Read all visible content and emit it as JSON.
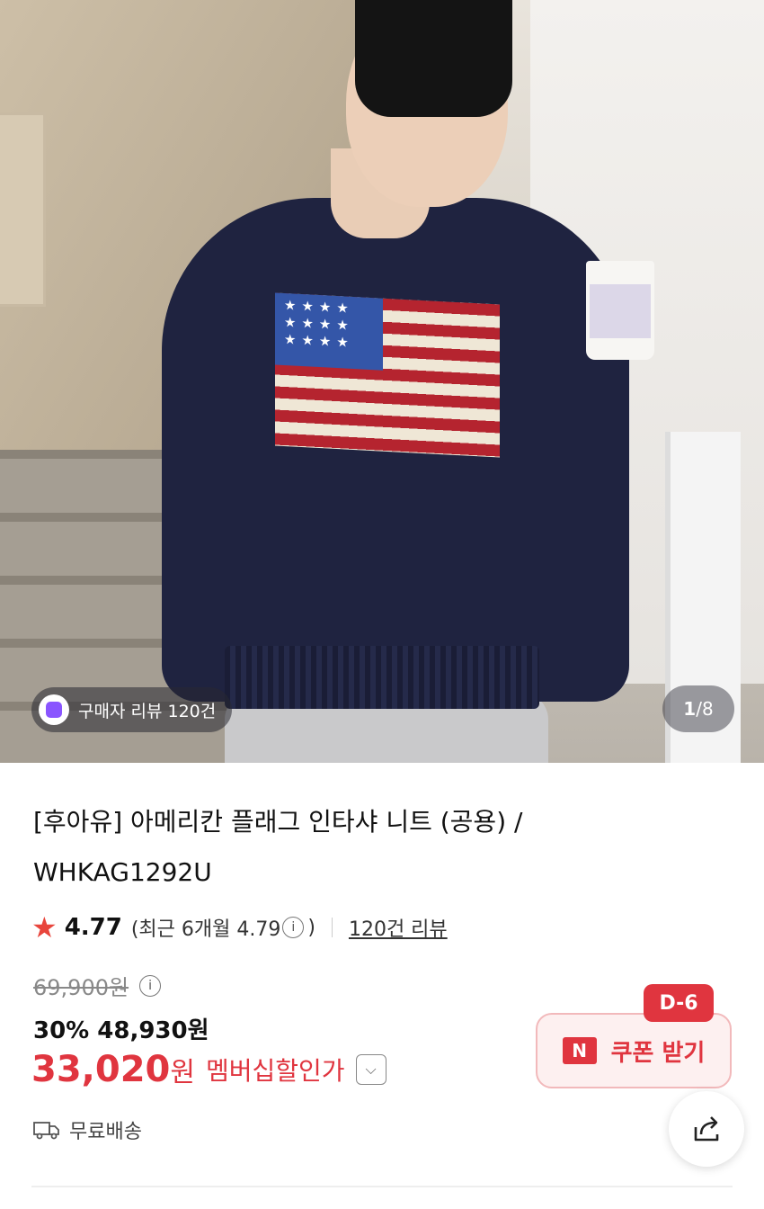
{
  "hero": {
    "review_badge": "구매자 리뷰 120건",
    "counter_current": "1",
    "counter_total": "/8"
  },
  "product": {
    "title_line1": "[후아유] 아메리칸 플래그 인타샤 니트 (공용) /",
    "title_line2": "WHKAG1292U"
  },
  "rating": {
    "score": "4.77",
    "recent_prefix": "(최근 6개월 4.79",
    "recent_suffix": ")",
    "review_link": "120건 리뷰"
  },
  "price": {
    "original": "69,900원",
    "discount": "30% 48,930원",
    "member_price": "33,020",
    "member_won": "원",
    "member_label": "멤버십할인가"
  },
  "shipping": {
    "label": "무료배송"
  },
  "coupon": {
    "dday": "D-6",
    "n_mark": "N",
    "label": "쿠폰 받기"
  },
  "colors": {
    "accent": "#e0353f",
    "badge_purple": "#8a55ff"
  },
  "icons": [
    "shopping-bag-icon",
    "star-icon",
    "info-icon",
    "chevron-down-icon",
    "truck-icon",
    "share-icon"
  ]
}
